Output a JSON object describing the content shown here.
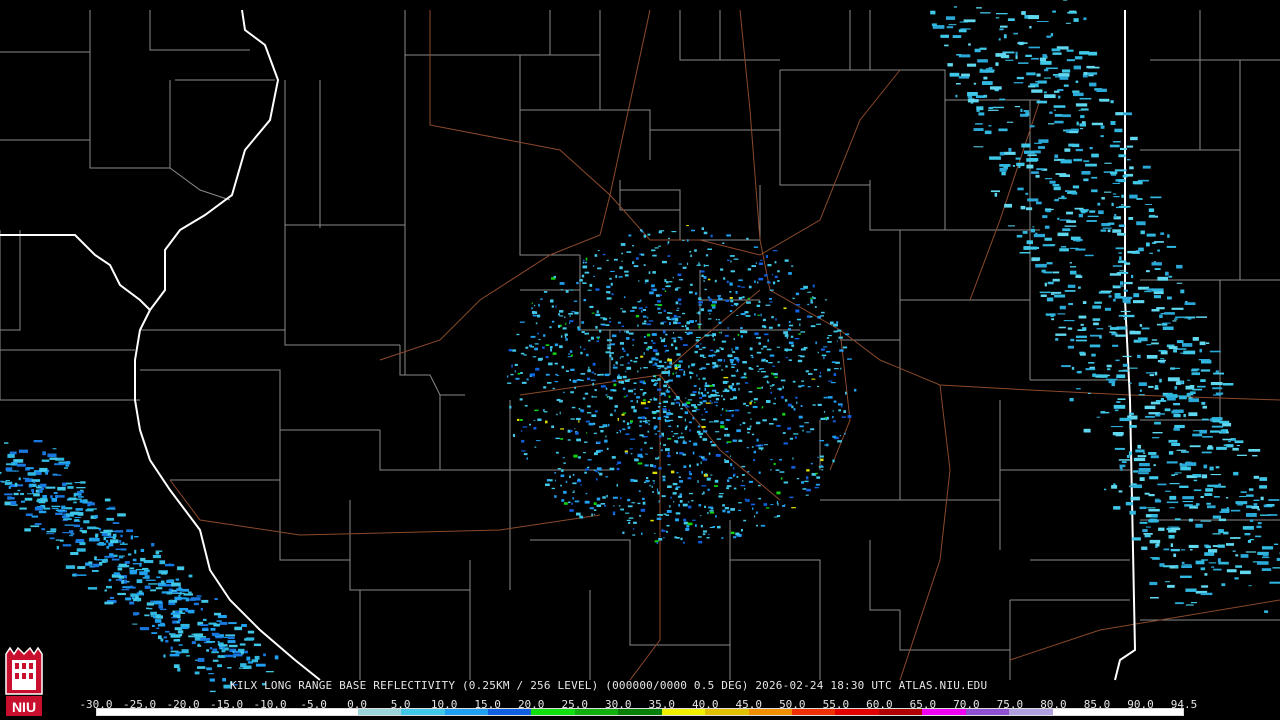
{
  "caption": "KILX LONG RANGE BASE REFLECTIVITY (0.25KM / 256 LEVEL) (000000/0000 0.5 DEG) 2026-02-24 18:30 UTC  ATLAS.NIU.EDU",
  "logo_text": "NIU",
  "scale": {
    "labels": [
      "-30.0",
      "-25.0",
      "-20.0",
      "-15.0",
      "-10.0",
      "-5.0",
      "0.0",
      "5.0",
      "10.0",
      "15.0",
      "20.0",
      "25.0",
      "30.0",
      "35.0",
      "40.0",
      "45.0",
      "50.0",
      "55.0",
      "60.0",
      "65.0",
      "70.0",
      "75.0",
      "80.0",
      "85.0",
      "90.0",
      "94.5"
    ],
    "colors": [
      "#ffffff",
      "#ffffff",
      "#ffffff",
      "#ffffff",
      "#ffffff",
      "#ffffff",
      "#9cd4dc",
      "#40c8e8",
      "#20a0f0",
      "#1060e0",
      "#10e010",
      "#10b010",
      "#088008",
      "#f0f000",
      "#e0c000",
      "#f09000",
      "#f03000",
      "#e00000",
      "#b00000",
      "#f000f0",
      "#9050d0",
      "#b0a0e0",
      "#ffffff",
      "#ffffff",
      "#ffffff"
    ]
  },
  "colors": {
    "state_border": "#ffffff",
    "county_border": "#8a8a8a",
    "highway": "#8b4a2b"
  }
}
